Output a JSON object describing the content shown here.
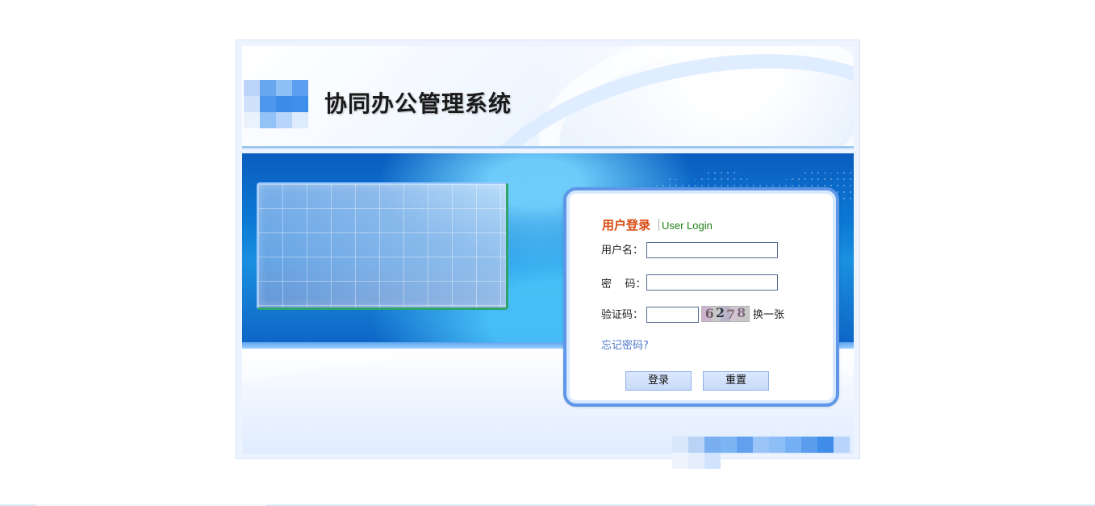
{
  "header": {
    "title": "协同办公管理系统"
  },
  "login_box": {
    "title_cn": "用户登录",
    "title_en": "User Login",
    "username_label": "用户名：",
    "password_label": "密    码：",
    "captcha_label": "验证码：",
    "username_value": "",
    "password_value": "",
    "captcha_value": "",
    "captcha_text": [
      "6",
      "2",
      "7",
      "8"
    ],
    "refresh_label": "换一张",
    "forgot_label": "忘记密码?",
    "login_button": "登录",
    "reset_button": "重置"
  },
  "icons": {
    "logo": "pixelated-logo-icon",
    "footer": "pixelated-footer-icon"
  },
  "colors": {
    "accent_blue": "#0b5dbf",
    "login_title_orange": "#d94a12",
    "login_title_green": "#1d7f12",
    "link_blue": "#4b77c9",
    "button_fill": "#c9daf9"
  }
}
